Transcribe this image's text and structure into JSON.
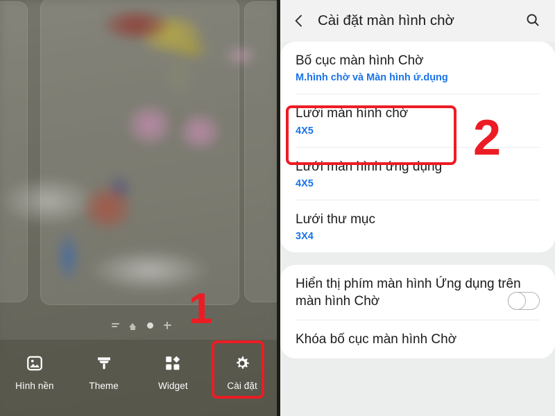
{
  "left_panel": {
    "page_indicator": {
      "icons": [
        "lines-icon",
        "home-icon",
        "page-dot-active",
        "add-page-icon"
      ]
    },
    "bottom_bar": {
      "items": [
        {
          "label": "Hình nền",
          "icon": "image-icon"
        },
        {
          "label": "Theme",
          "icon": "paintbrush-icon"
        },
        {
          "label": "Widget",
          "icon": "widget-squares-icon"
        },
        {
          "label": "Cài đặt",
          "icon": "gear-icon"
        }
      ]
    }
  },
  "annotations": {
    "step_one": "1",
    "step_two": "2",
    "color": "#ed1c24"
  },
  "right_panel": {
    "header": {
      "back_icon": "chevron-left-icon",
      "title": "Cài đặt màn hình chờ",
      "search_icon": "search-icon"
    },
    "sections": [
      {
        "rows": [
          {
            "title": "Bố cục màn hình Chờ",
            "value": "M.hình chờ và Màn hình ứ.dụng"
          },
          {
            "title": "Lưới màn hình chờ",
            "value": "4X5"
          },
          {
            "title": "Lưới màn hình ứng dụng",
            "value": "4X5"
          },
          {
            "title": "Lưới thư mục",
            "value": "3X4"
          }
        ]
      },
      {
        "rows": [
          {
            "title": "Hiển thị phím màn hình Ứng dụng trên màn hình Chờ",
            "value": "",
            "toggle": "off"
          },
          {
            "title": "Khóa bố cục màn hình Chờ",
            "value": ""
          }
        ]
      }
    ],
    "accent_color": "#1a73e8"
  }
}
